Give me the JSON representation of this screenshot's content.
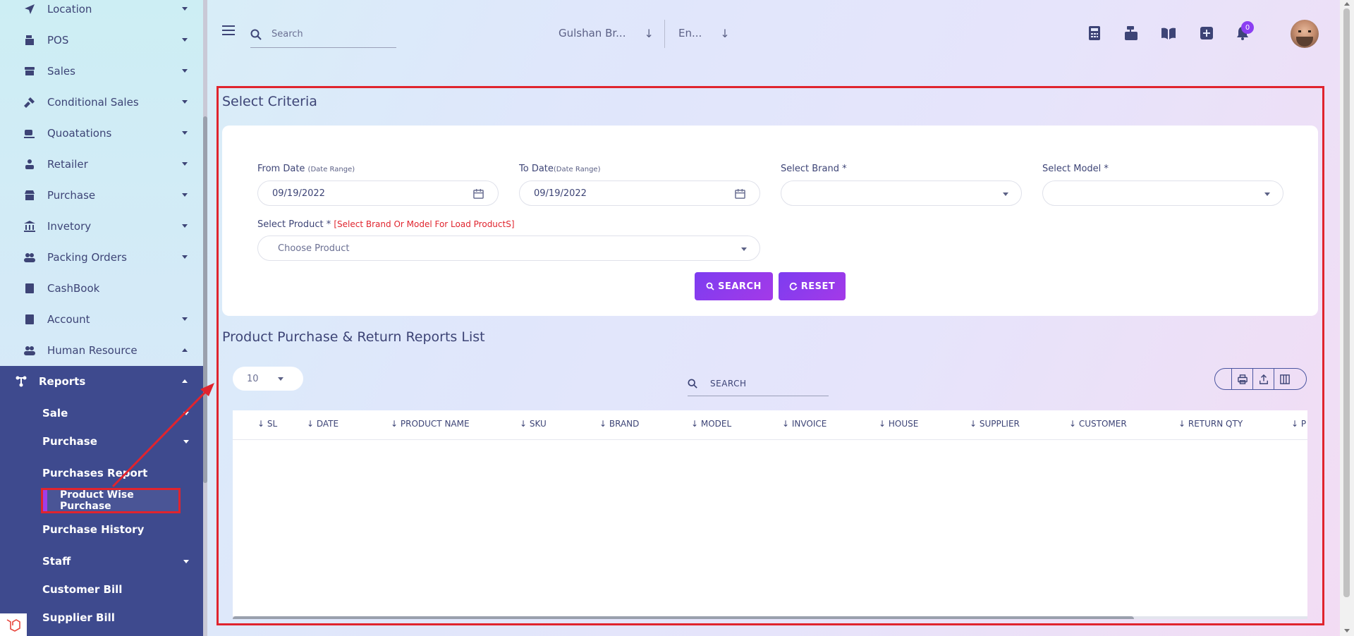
{
  "sidebar": {
    "items": [
      {
        "label": "Location",
        "icon": "location-arrow-icon",
        "caret": "down"
      },
      {
        "label": "POS",
        "icon": "pos-icon",
        "caret": "down"
      },
      {
        "label": "Sales",
        "icon": "store-icon",
        "caret": "down"
      },
      {
        "label": "Conditional Sales",
        "icon": "hammer-icon",
        "caret": "down"
      },
      {
        "label": "Quoatations",
        "icon": "cup-icon",
        "caret": "down"
      },
      {
        "label": "Retailer",
        "icon": "retailer-icon",
        "caret": "down"
      },
      {
        "label": "Purchase",
        "icon": "shop-icon",
        "caret": "down"
      },
      {
        "label": "Invetory",
        "icon": "bank-icon",
        "caret": "down"
      },
      {
        "label": "Packing Orders",
        "icon": "users-icon",
        "caret": "down"
      },
      {
        "label": "CashBook",
        "icon": "book-icon",
        "caret": ""
      },
      {
        "label": "Account",
        "icon": "calculator-icon",
        "caret": "down"
      },
      {
        "label": "Human Resource",
        "icon": "users-icon",
        "caret": "up"
      }
    ],
    "reports": {
      "label": "Reports",
      "children": {
        "sale": "Sale",
        "purchase": "Purchase",
        "purchases_report": "Purchases Report",
        "product_wise_purchase": "Product Wise Purchase",
        "purchase_history": "Purchase History",
        "staff": "Staff",
        "customer_bill": "Customer Bill",
        "supplier_bill": "Supplier Bill"
      }
    }
  },
  "header": {
    "search_placeholder": "Search",
    "branch": "Gulshan Br...",
    "language": "En...",
    "notification_count": "0"
  },
  "criteria": {
    "title": "Select Criteria",
    "from_date_label": "From Date ",
    "from_date_hint": "(Date Range)",
    "from_date_value": "09/19/2022",
    "to_date_label": "To Date",
    "to_date_hint": "(Date Range)",
    "to_date_value": "09/19/2022",
    "brand_label": "Select Brand *",
    "model_label": "Select Model *",
    "product_label": "Select Product * ",
    "product_warning": "[Select Brand Or Model For Load ProductS]",
    "product_placeholder": "Choose Product",
    "search_button": "SEARCH",
    "reset_button": "RESET"
  },
  "report_list": {
    "title": "Product Purchase & Return Reports List",
    "page_size": "10",
    "search_placeholder": "SEARCH",
    "columns": [
      "SL",
      "DATE",
      "PRODUCT NAME",
      "SKU",
      "BRAND",
      "MODEL",
      "INVOICE",
      "HOUSE",
      "SUPPLIER",
      "CUSTOMER",
      "RETURN QTY",
      "P"
    ]
  },
  "colors": {
    "accent": "#8b3ff2",
    "sidebar_active": "#3e4a8e",
    "annotation": "#e0242e"
  }
}
